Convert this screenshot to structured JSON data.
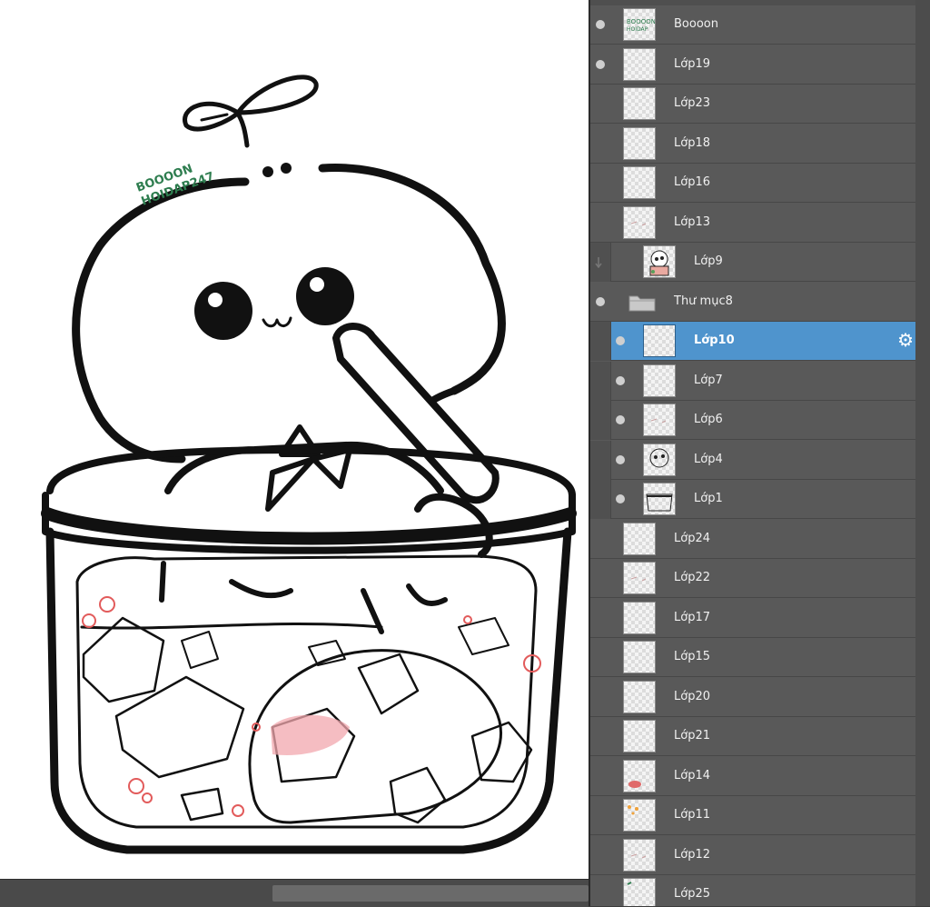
{
  "watermark": {
    "line1": "BOOOON",
    "line2": "HOIDAP247"
  },
  "layers_panel": {
    "layers": [
      {
        "name": "Boooon",
        "visible": true,
        "thumb": "text-watermark"
      },
      {
        "name": "Lớp19",
        "visible": true,
        "thumb": "empty"
      },
      {
        "name": "Lớp23",
        "visible": false,
        "thumb": "empty"
      },
      {
        "name": "Lớp18",
        "visible": false,
        "thumb": "empty"
      },
      {
        "name": "Lớp16",
        "visible": false,
        "thumb": "empty"
      },
      {
        "name": "Lớp13",
        "visible": false,
        "thumb": "faint-marks"
      },
      {
        "name": "Lớp9",
        "visible": false,
        "thumb": "color-character"
      },
      {
        "name": "Thư mục8",
        "visible": true,
        "thumb": "folder-icon"
      },
      {
        "name": "Lớp10",
        "visible": true,
        "thumb": "empty",
        "selected": true
      },
      {
        "name": "Lớp7",
        "visible": true,
        "thumb": "empty"
      },
      {
        "name": "Lớp6",
        "visible": true,
        "thumb": "faint-marks"
      },
      {
        "name": "Lớp4",
        "visible": true,
        "thumb": "character-sketch"
      },
      {
        "name": "Lớp1",
        "visible": true,
        "thumb": "jar-sketch"
      },
      {
        "name": "Lớp24",
        "visible": false,
        "thumb": "empty"
      },
      {
        "name": "Lớp22",
        "visible": false,
        "thumb": "faint-marks"
      },
      {
        "name": "Lớp17",
        "visible": false,
        "thumb": "empty"
      },
      {
        "name": "Lớp15",
        "visible": false,
        "thumb": "empty"
      },
      {
        "name": "Lớp20",
        "visible": false,
        "thumb": "empty"
      },
      {
        "name": "Lớp21",
        "visible": false,
        "thumb": "empty"
      },
      {
        "name": "Lớp14",
        "visible": false,
        "thumb": "red-blush"
      },
      {
        "name": "Lớp11",
        "visible": false,
        "thumb": "orange-dots"
      },
      {
        "name": "Lớp12",
        "visible": false,
        "thumb": "faint-marks"
      },
      {
        "name": "Lớp25",
        "visible": false,
        "thumb": "green-mark"
      }
    ]
  },
  "colors": {
    "selected_row": "#4f94cd",
    "panel_bg": "#595959",
    "watermark_green": "#2e7d4f"
  }
}
